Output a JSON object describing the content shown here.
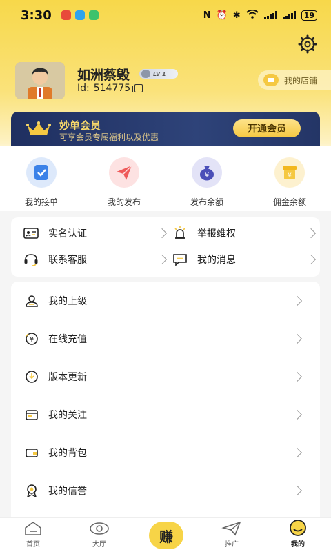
{
  "status_bar": {
    "time": "3:30",
    "battery": "19"
  },
  "profile": {
    "name": "如洲蔡毁",
    "level": "LV 1",
    "id_label": "Id:",
    "id_value": "514775",
    "store_label": "我的店铺"
  },
  "vip": {
    "title": "妙单会员",
    "subtitle": "可享会员专属福利以及优惠",
    "button": "开通会员"
  },
  "quick_actions": [
    {
      "label": "我的接单",
      "icon": "task-check-icon"
    },
    {
      "label": "我的发布",
      "icon": "paper-plane-icon"
    },
    {
      "label": "发布余额",
      "icon": "money-bag-icon"
    },
    {
      "label": "佣金余额",
      "icon": "yen-box-icon"
    }
  ],
  "services": [
    {
      "label": "实名认证",
      "icon": "id-card-icon"
    },
    {
      "label": "举报维权",
      "icon": "alarm-light-icon"
    },
    {
      "label": "联系客服",
      "icon": "headset-icon"
    },
    {
      "label": "我的消息",
      "icon": "message-icon"
    }
  ],
  "menu": [
    {
      "label": "我的上级",
      "icon": "user-icon"
    },
    {
      "label": "在线充值",
      "icon": "yen-icon"
    },
    {
      "label": "版本更新",
      "icon": "update-icon"
    },
    {
      "label": "我的关注",
      "icon": "follow-icon"
    },
    {
      "label": "我的背包",
      "icon": "wallet-icon"
    },
    {
      "label": "我的信誉",
      "icon": "medal-icon"
    }
  ],
  "tabbar": {
    "items": [
      {
        "label": "首页"
      },
      {
        "label": "大厅"
      },
      {
        "label": ""
      },
      {
        "label": "推广"
      },
      {
        "label": "我的"
      }
    ],
    "center_label": "赚"
  },
  "colors": {
    "accent": "#f7d447",
    "vip_bg": "#2a3c70",
    "vip_gold": "#f7d86a"
  }
}
